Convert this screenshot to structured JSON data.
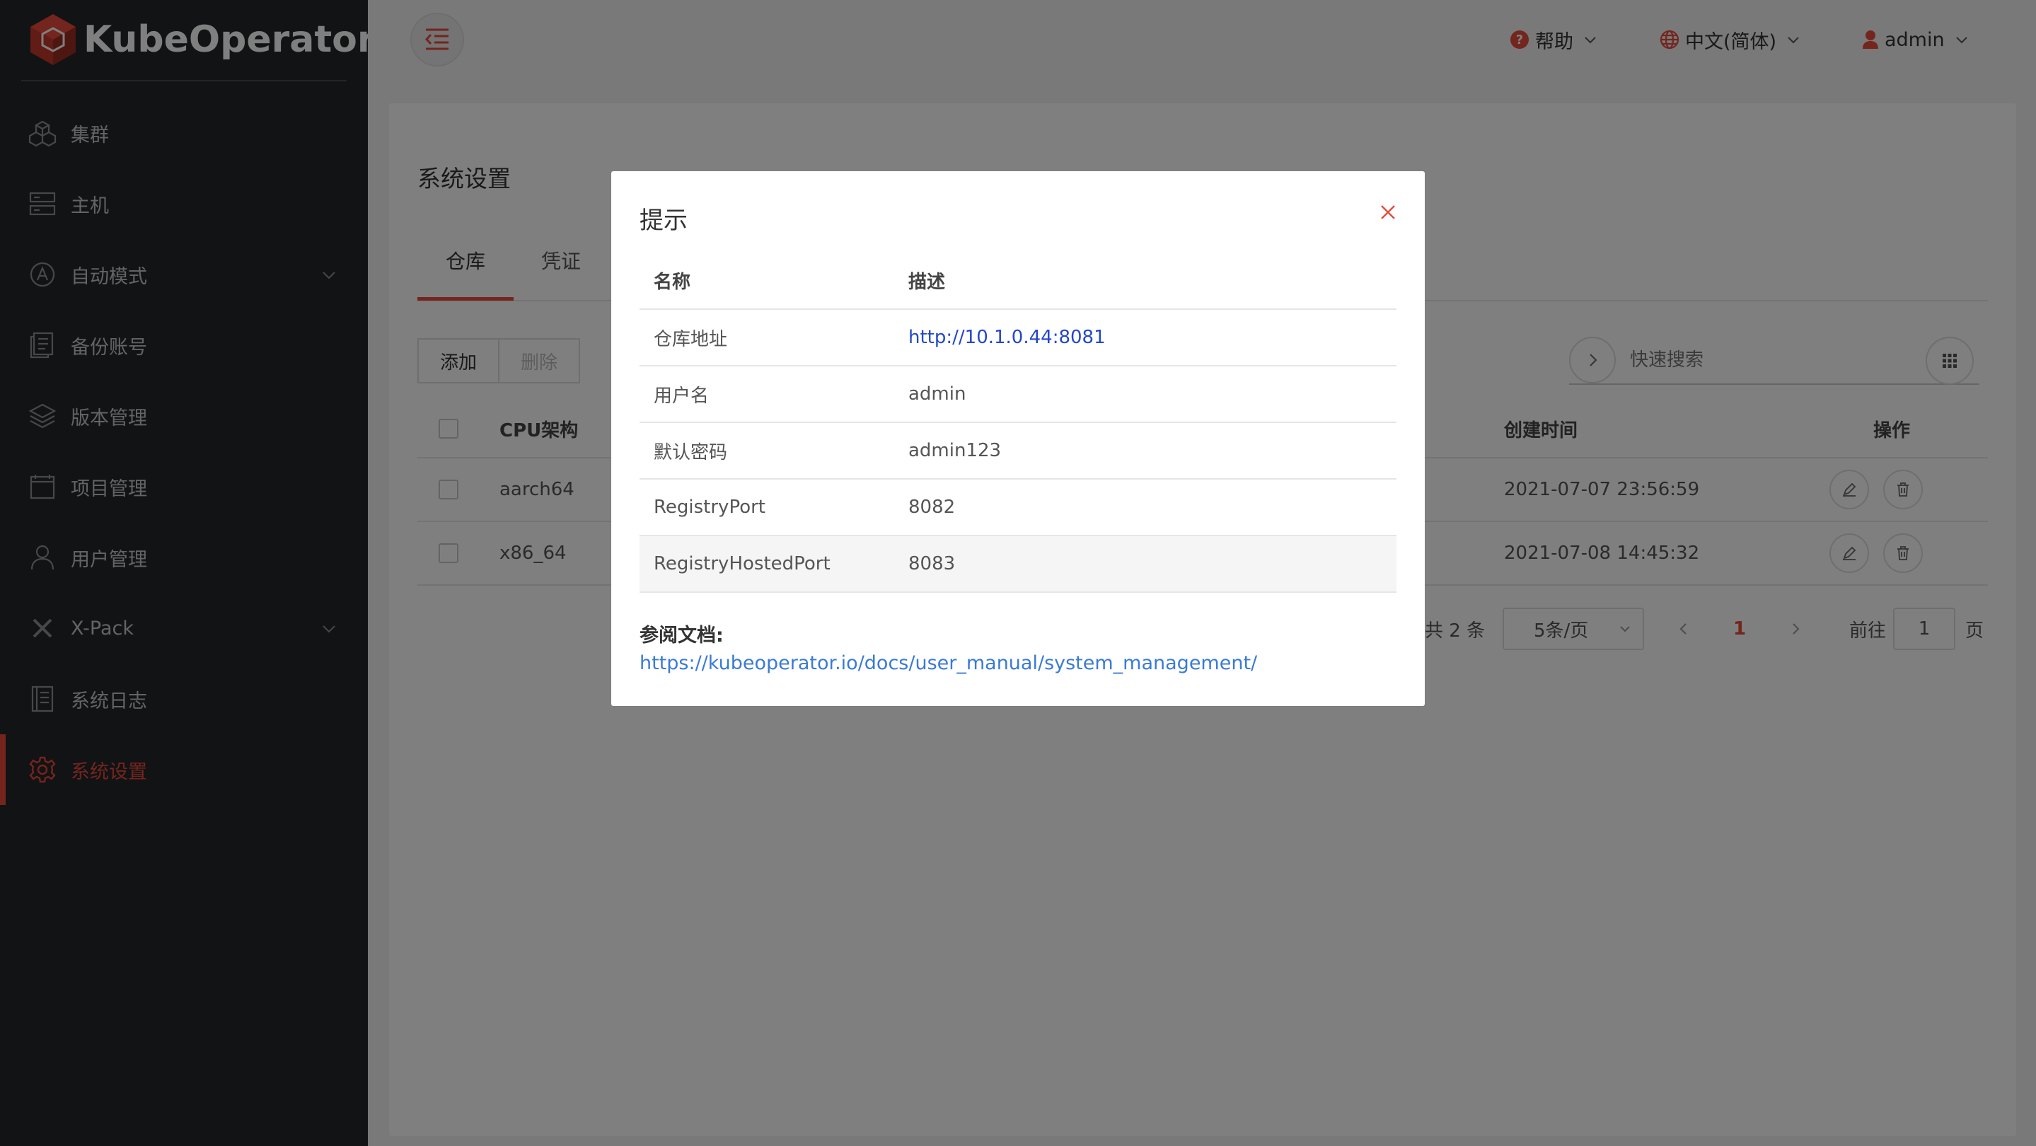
{
  "brand": {
    "name": "KubeOperator",
    "color": "#e64a3c"
  },
  "sidebar": {
    "items": [
      {
        "label": "集群",
        "icon": "cubes-icon"
      },
      {
        "label": "主机",
        "icon": "server-icon"
      },
      {
        "label": "自动模式",
        "icon": "auto-mode-icon",
        "expandable": true
      },
      {
        "label": "备份账号",
        "icon": "backup-icon"
      },
      {
        "label": "版本管理",
        "icon": "layers-icon"
      },
      {
        "label": "项目管理",
        "icon": "project-icon"
      },
      {
        "label": "用户管理",
        "icon": "user-icon"
      },
      {
        "label": "X-Pack",
        "icon": "xpack-icon",
        "expandable": true
      },
      {
        "label": "系统日志",
        "icon": "log-icon"
      },
      {
        "label": "系统设置",
        "icon": "gear-icon",
        "active": true
      }
    ]
  },
  "header": {
    "help": "帮助",
    "language": "中文(简体)",
    "user": "admin"
  },
  "main": {
    "title": "系统设置",
    "tabs": [
      "仓库",
      "凭证"
    ],
    "buttons": {
      "add": "添加",
      "delete": "删除"
    },
    "search_placeholder": "快速搜索",
    "table": {
      "columns": {
        "cpu_arch": "CPU架构",
        "created": "创建时间",
        "actions": "操作"
      },
      "rows": [
        {
          "cpu_arch": "aarch64",
          "created": "2021-07-07 23:56:59"
        },
        {
          "cpu_arch": "x86_64",
          "created": "2021-07-08 14:45:32"
        }
      ]
    },
    "pagination": {
      "total": "共 2 条",
      "page_size": "5条/页",
      "current": "1",
      "goto_label": "前往",
      "goto_value": "1",
      "page_suffix": "页"
    }
  },
  "dialog": {
    "title": "提示",
    "columns": {
      "name": "名称",
      "desc": "描述"
    },
    "rows": [
      {
        "name": "仓库地址",
        "desc": "http://10.1.0.44:8081"
      },
      {
        "name": "用户名",
        "desc": "admin"
      },
      {
        "name": "默认密码",
        "desc": "admin123"
      },
      {
        "name": "RegistryPort",
        "desc": "8082"
      },
      {
        "name": "RegistryHostedPort",
        "desc": "8083"
      }
    ],
    "ref_title": "参阅文档:",
    "ref_link": "https://kubeoperator.io/docs/user_manual/system_management/"
  }
}
